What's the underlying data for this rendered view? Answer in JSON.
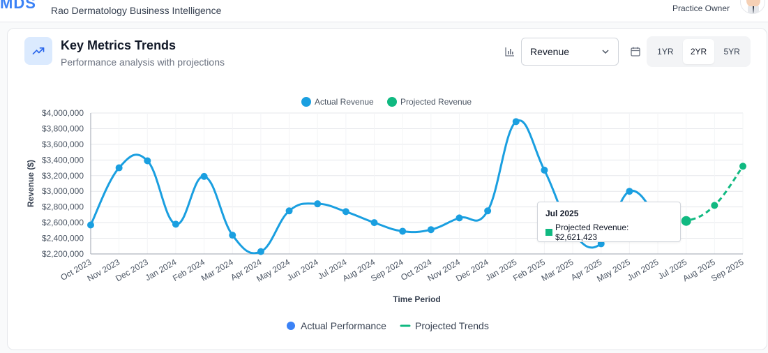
{
  "header": {
    "logo_text": "MDS",
    "subtitle": "Rao Dermatology Business Intelligence",
    "role": "Practice Owner"
  },
  "card": {
    "title": "Key Metrics Trends",
    "subtitle": "Performance analysis with projections",
    "metric_select": {
      "value": "Revenue"
    },
    "ranges": [
      "1YR",
      "2YR",
      "5YR"
    ],
    "active_range": "2YR"
  },
  "tooltip": {
    "title": "Jul 2025",
    "label": "Projected Revenue: $2,621,423"
  },
  "colors": {
    "actual": "#1a9fe0",
    "projected": "#10b981",
    "performance_dot": "#3b82f6",
    "grid": "#e5e7eb"
  },
  "chart_data": {
    "type": "line",
    "xlabel": "Time Period",
    "ylabel": "Revenue ($)",
    "ylim": [
      2200000,
      4000000
    ],
    "yticks": [
      2200000,
      2400000,
      2600000,
      2800000,
      3000000,
      3200000,
      3400000,
      3600000,
      3800000,
      4000000
    ],
    "ytick_labels": [
      "$2,200,000",
      "$2,400,000",
      "$2,600,000",
      "$2,800,000",
      "$3,000,000",
      "$3,200,000",
      "$3,400,000",
      "$3,600,000",
      "$3,800,000",
      "$4,000,000"
    ],
    "categories": [
      "Oct 2023",
      "Nov 2023",
      "Dec 2023",
      "Jan 2024",
      "Feb 2024",
      "Mar 2024",
      "Apr 2024",
      "May 2024",
      "Jun 2024",
      "Jul 2024",
      "Aug 2024",
      "Sep 2024",
      "Oct 2024",
      "Nov 2024",
      "Dec 2024",
      "Jan 2025",
      "Feb 2025",
      "Mar 2025",
      "Apr 2025",
      "May 2025",
      "Jun 2025",
      "Jul 2025",
      "Aug 2025",
      "Sep 2025"
    ],
    "legend_top": [
      "Actual Revenue",
      "Projected Revenue"
    ],
    "legend_bottom": [
      "Actual Performance",
      "Projected Trends"
    ],
    "series": [
      {
        "name": "Actual Revenue",
        "style": "solid",
        "values": [
          2570000,
          3300000,
          3390000,
          2580000,
          3190000,
          2440000,
          2230000,
          2750000,
          2840000,
          2740000,
          2600000,
          2490000,
          2510000,
          2660000,
          2750000,
          3890000,
          3270000,
          2480000,
          2330000,
          3000000,
          2640000,
          null,
          null,
          null
        ]
      },
      {
        "name": "Projected Revenue",
        "style": "dashed",
        "values": [
          null,
          null,
          null,
          null,
          null,
          null,
          null,
          null,
          null,
          null,
          null,
          null,
          null,
          null,
          null,
          null,
          null,
          null,
          null,
          null,
          null,
          2621423,
          2820000,
          3320000
        ]
      }
    ],
    "highlight_index": 21
  }
}
